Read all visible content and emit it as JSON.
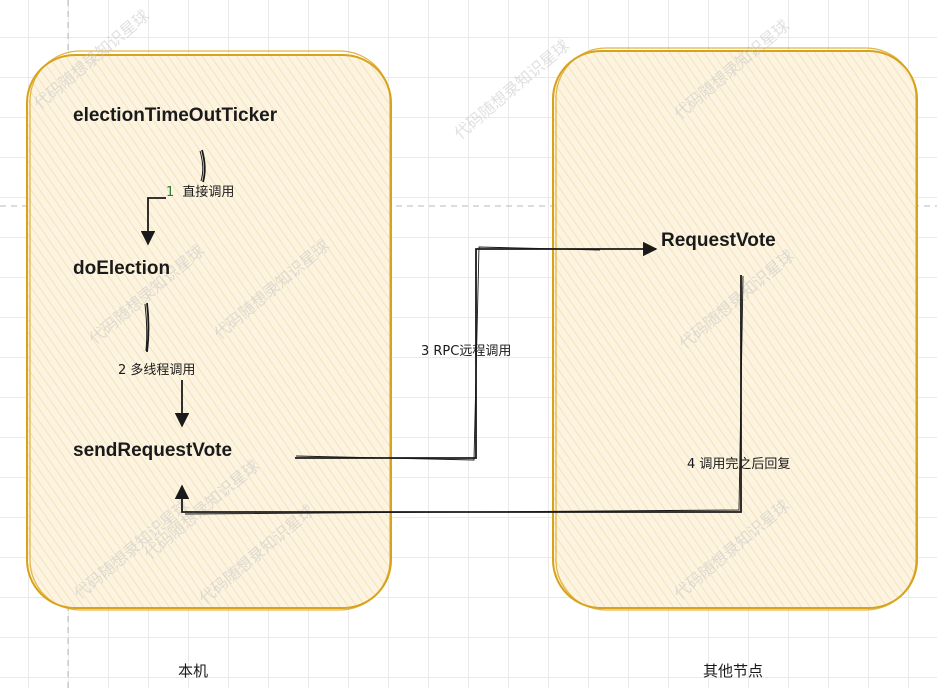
{
  "colors": {
    "box_stroke": "#d8a21a",
    "box_fill": "#fbf1d9",
    "line": "#1a1a1a",
    "step_number": "#2e7d32"
  },
  "local_node": {
    "caption": "本机",
    "nodes": {
      "ticker": "electionTimeOutTicker",
      "do_election": "doElection",
      "send_request_vote": "sendRequestVote"
    }
  },
  "remote_node": {
    "caption": "其他节点",
    "nodes": {
      "request_vote": "RequestVote"
    }
  },
  "edges": {
    "step1": {
      "number": "1",
      "text": "直接调用"
    },
    "step2": {
      "text": "2 多线程调用"
    },
    "step3": {
      "text": "3 RPC远程调用"
    },
    "step4": {
      "text": "4 调用完之后回复"
    }
  },
  "watermark": "代码随想录知识星球"
}
